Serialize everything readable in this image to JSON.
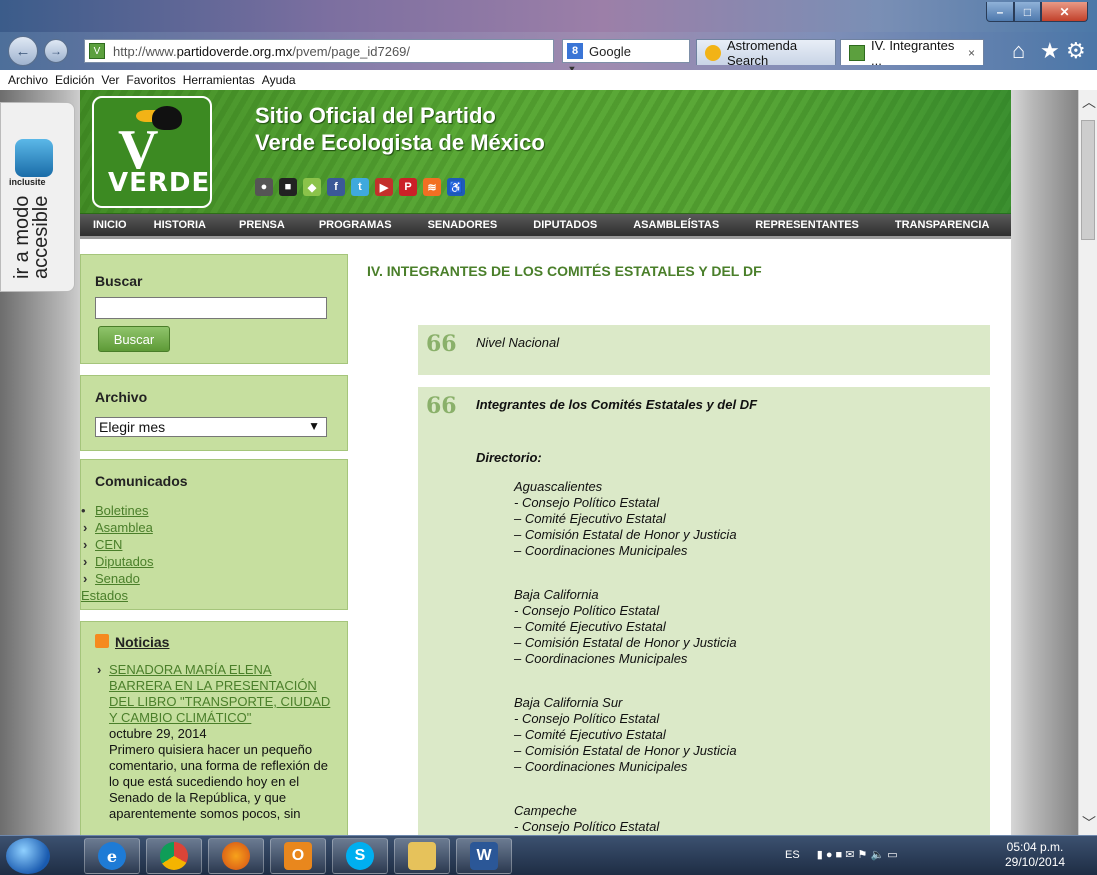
{
  "browser": {
    "url_prefix": "http://www.",
    "url_domain": "partidoverde.org.mx",
    "url_path": "/pvem/page_id7269/",
    "search_engine": "Google",
    "tabs": [
      {
        "label": "Astromenda Search"
      },
      {
        "label": "IV. Integrantes ...",
        "close": "×"
      }
    ]
  },
  "menubar": [
    "Archivo",
    "Edición",
    "Ver",
    "Favoritos",
    "Herramientas",
    "Ayuda"
  ],
  "inclusite": {
    "name": "inclusite",
    "text_line1": "ir a modo",
    "text_line2": "accesible"
  },
  "header": {
    "logo_text": "VERDE",
    "title_line1": "Sitio Oficial del Partido",
    "title_line2": "Verde Ecologista de México"
  },
  "nav": [
    "INICIO",
    "HISTORIA",
    "PRENSA",
    "PROGRAMAS",
    "SENADORES",
    "DIPUTADOS",
    "ASAMBLEÍSTAS",
    "REPRESENTANTES",
    "TRANSPARENCIA"
  ],
  "sidebar": {
    "search": {
      "title": "Buscar",
      "button": "Buscar",
      "value": ""
    },
    "archive": {
      "title": "Archivo",
      "selected": "Elegir mes"
    },
    "comunicados": {
      "title": "Comunicados",
      "items": [
        "Boletines",
        "Asamblea",
        "CEN",
        "Diputados",
        "Senado",
        "Estados"
      ]
    },
    "noticias": {
      "title": "Noticias",
      "headline": "SENADORA MARÍA ELENA BARRERA EN LA PRESENTACIÓN DEL LIBRO \"TRANSPORTE, CIUDAD Y CAMBIO CLIMÁTICO\"",
      "date": "octubre 29, 2014",
      "excerpt": "Primero quisiera hacer un pequeño comentario, una forma de reflexión de lo que está sucediendo hoy en el Senado de la República, y que aparentemente somos pocos, sin"
    }
  },
  "main": {
    "title": "IV. INTEGRANTES DE LOS COMITÉS ESTATALES Y DEL DF",
    "block1": {
      "quote": "66",
      "text": "Nivel Nacional"
    },
    "block2": {
      "quote": "66",
      "heading": "Integrantes de los Comités Estatales y del DF",
      "subheading": "Directorio:",
      "states": [
        {
          "name": "Aguascalientes",
          "lines": [
            "- Consejo Político Estatal",
            "– Comité Ejecutivo Estatal",
            "– Comisión Estatal de Honor y Justicia",
            "– Coordinaciones Municipales"
          ]
        },
        {
          "name": "Baja California",
          "lines": [
            "- Consejo Político Estatal",
            "– Comité Ejecutivo Estatal",
            "– Comisión Estatal de Honor y Justicia",
            "– Coordinaciones Municipales"
          ]
        },
        {
          "name": "Baja California Sur",
          "lines": [
            "- Consejo Político Estatal",
            "– Comité Ejecutivo Estatal",
            "– Comisión Estatal de Honor y Justicia",
            "– Coordinaciones Municipales"
          ]
        },
        {
          "name": "Campeche",
          "lines": [
            "- Consejo Político Estatal"
          ]
        }
      ]
    }
  },
  "taskbar": {
    "lang": "ES",
    "time": "05:04 p.m.",
    "date": "29/10/2014"
  },
  "colors": {
    "brand_green": "#4f9a2e",
    "sidebar_bg": "#c6df9f",
    "link_green": "#4a7f2a",
    "content_bg": "#dbe9c8"
  }
}
